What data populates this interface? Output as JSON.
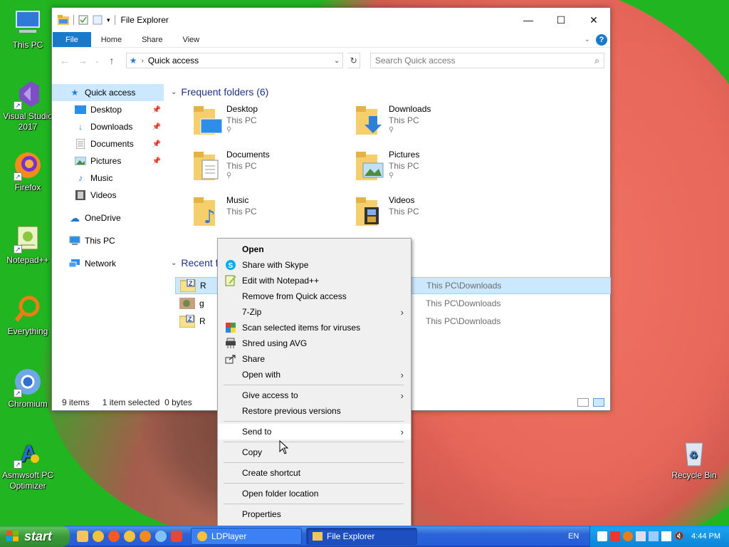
{
  "desktop": {
    "icons": [
      {
        "label": "This PC"
      },
      {
        "label": "Visual Studio 2017"
      },
      {
        "label": "Firefox"
      },
      {
        "label": "Notepad++"
      },
      {
        "label": "Everything"
      },
      {
        "label": "Chromium"
      },
      {
        "label": "Asmwsoft PC Optimizer"
      },
      {
        "label": "Recycle Bin"
      }
    ]
  },
  "window": {
    "title": "File Explorer",
    "ribbon_tabs": [
      "File",
      "Home",
      "Share",
      "View"
    ],
    "help_label": "?",
    "controls": {
      "minimize": "—",
      "maximize": "☐",
      "close": "✕"
    },
    "address": "Quick access",
    "search_placeholder": "Search Quick access"
  },
  "sidebar": {
    "quick_access": "Quick access",
    "pinned": [
      {
        "label": "Desktop",
        "icon": "desktop-icon"
      },
      {
        "label": "Downloads",
        "icon": "downloads-icon"
      },
      {
        "label": "Documents",
        "icon": "documents-icon"
      },
      {
        "label": "Pictures",
        "icon": "pictures-icon"
      },
      {
        "label": "Music",
        "icon": "music-icon"
      },
      {
        "label": "Videos",
        "icon": "videos-icon"
      }
    ],
    "onedrive": "OneDrive",
    "this_pc": "This PC",
    "network": "Network"
  },
  "frequent": {
    "header": "Frequent folders (6)",
    "folders": [
      {
        "name": "Desktop",
        "location": "This PC"
      },
      {
        "name": "Downloads",
        "location": "This PC"
      },
      {
        "name": "Documents",
        "location": "This PC"
      },
      {
        "name": "Pictures",
        "location": "This PC"
      },
      {
        "name": "Music",
        "location": "This PC"
      },
      {
        "name": "Videos",
        "location": "This PC"
      }
    ]
  },
  "recent": {
    "header": "Recent f",
    "rows": [
      {
        "name": "R",
        "path": "This PC\\Downloads"
      },
      {
        "name": "g",
        "path": "This PC\\Downloads"
      },
      {
        "name": "R",
        "path": "This PC\\Downloads"
      }
    ]
  },
  "status": {
    "items": "9 items",
    "selected": "1 item selected",
    "size": "0 bytes"
  },
  "context_menu": {
    "items": [
      {
        "label": "Open"
      },
      {
        "label": "Share with Skype"
      },
      {
        "label": "Edit with Notepad++"
      },
      {
        "label": "Remove from Quick access"
      },
      {
        "label": "7-Zip"
      },
      {
        "label": "Scan selected items for viruses"
      },
      {
        "label": "Shred using AVG"
      },
      {
        "label": "Share"
      },
      {
        "label": "Open with"
      },
      {
        "label": "Give access to"
      },
      {
        "label": "Restore previous versions"
      },
      {
        "label": "Send to"
      },
      {
        "label": "Copy"
      },
      {
        "label": "Create shortcut"
      },
      {
        "label": "Open folder location"
      },
      {
        "label": "Properties"
      }
    ]
  },
  "taskbar": {
    "start": "start",
    "tasks": [
      "LDPlayer",
      "File Explorer"
    ],
    "language": "EN",
    "clock": "4:44 PM"
  }
}
